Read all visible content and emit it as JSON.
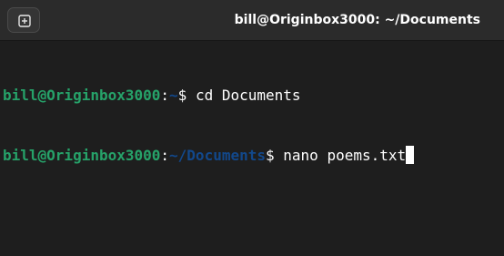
{
  "window": {
    "title": "bill@Originbox3000: ~/Documents",
    "new_tab_icon": "new-tab-icon"
  },
  "terminal": {
    "lines": [
      {
        "user_host": "bill@Originbox3000",
        "sep": ":",
        "path": "~",
        "prompt": "$",
        "command": " cd Documents"
      },
      {
        "user_host": "bill@Originbox3000",
        "sep": ":",
        "path": "~/Documents",
        "prompt": "$",
        "command": " nano poems.txt"
      }
    ]
  },
  "colors": {
    "background": "#1e1e1e",
    "titlebar": "#2b2b2b",
    "user_host": "#26a269",
    "path": "#12488b",
    "text": "#ffffff"
  }
}
